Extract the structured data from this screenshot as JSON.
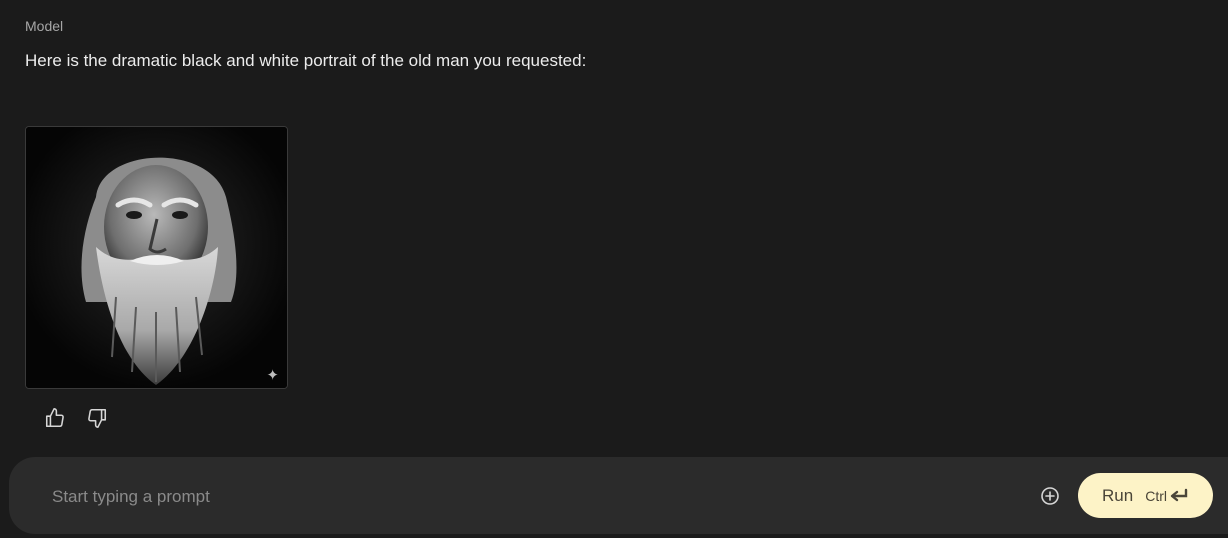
{
  "turn": {
    "role_label": "Model",
    "message": "Here is the dramatic black and white portrait of the old man you requested:"
  },
  "image": {
    "subject": "black and white portrait of an old man with long white beard",
    "badge_icon": "sparkle-icon"
  },
  "feedback": {
    "like_icon": "thumbs-up-icon",
    "dislike_icon": "thumbs-down-icon"
  },
  "composer": {
    "placeholder": "Start typing a prompt",
    "value": "",
    "add_icon": "plus-circle-icon",
    "run_label": "Run",
    "shortcut_label": "Ctrl",
    "shortcut_icon": "enter-icon",
    "run_color": "#fdf3c7"
  }
}
